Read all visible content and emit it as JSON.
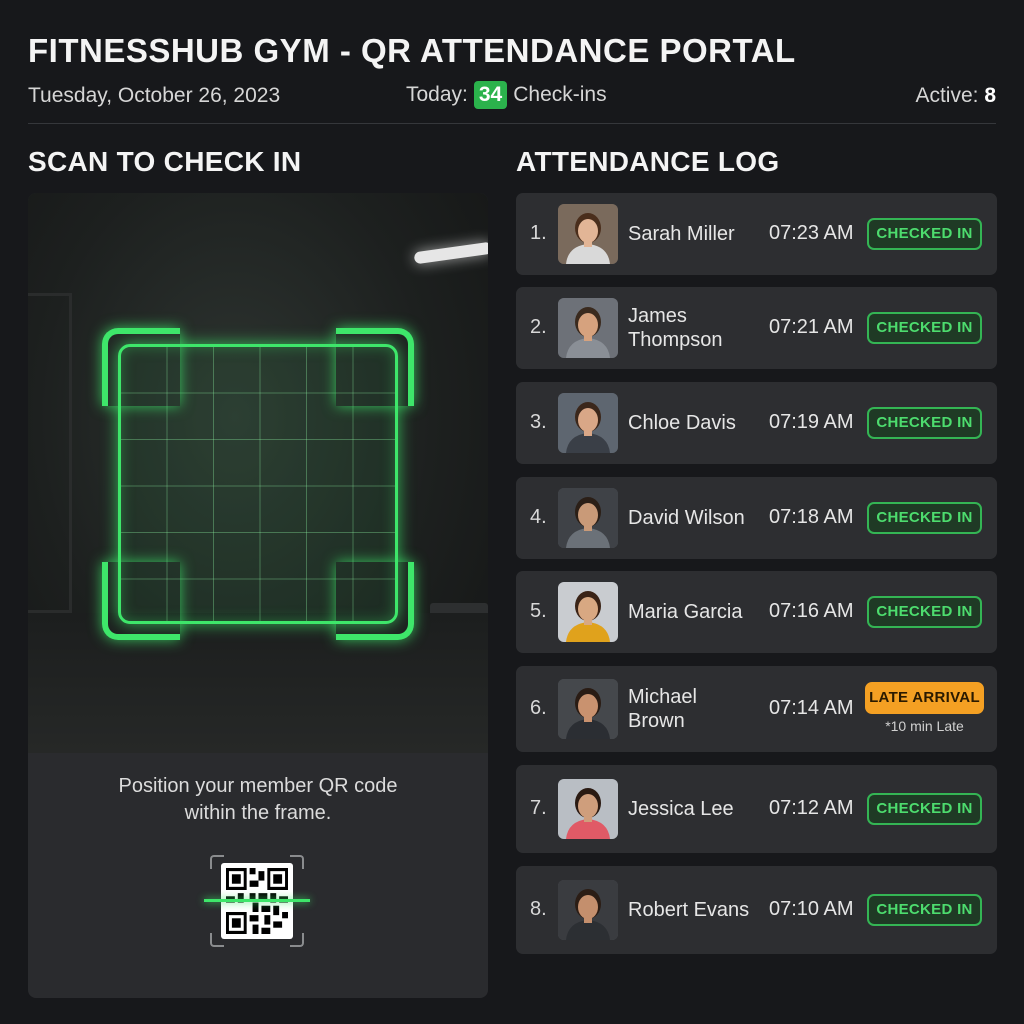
{
  "header": {
    "title": "FITNESSHUB GYM - QR ATTENDANCE PORTAL",
    "date": "Tuesday, October 26, 2023",
    "today_label": "Today:",
    "today_count": "34",
    "today_suffix": "Check-ins",
    "active_label": "Active:",
    "active_count": "8"
  },
  "scan": {
    "heading": "SCAN TO CHECK IN",
    "instruction_line1": "Position your member QR code",
    "instruction_line2": "within the frame."
  },
  "log": {
    "heading": "ATTENDANCE LOG",
    "rows": [
      {
        "num": "1.",
        "name_line1": "Sarah Miller",
        "name_line2": "",
        "time": "07:23 AM",
        "status": "CHECKED IN",
        "note": ""
      },
      {
        "num": "2.",
        "name_line1": "James",
        "name_line2": "Thompson",
        "time": "07:21 AM",
        "status": "CHECKED IN",
        "note": ""
      },
      {
        "num": "3.",
        "name_line1": "Chloe Davis",
        "name_line2": "",
        "time": "07:19 AM",
        "status": "CHECKED IN",
        "note": ""
      },
      {
        "num": "4.",
        "name_line1": "David Wilson",
        "name_line2": "",
        "time": "07:18 AM",
        "status": "CHECKED IN",
        "note": ""
      },
      {
        "num": "5.",
        "name_line1": "Maria Garcia",
        "name_line2": "",
        "time": "07:16 AM",
        "status": "CHECKED IN",
        "note": ""
      },
      {
        "num": "6.",
        "name_line1": "Michael",
        "name_line2": "Brown",
        "time": "07:14 AM",
        "status": "LATE ARRIVAL",
        "note": "*10 min Late"
      },
      {
        "num": "7.",
        "name_line1": "Jessica Lee",
        "name_line2": "",
        "time": "07:12 AM",
        "status": "CHECKED IN",
        "note": ""
      },
      {
        "num": "8.",
        "name_line1": "Robert Evans",
        "name_line2": "",
        "time": "07:10 AM",
        "status": "CHECKED IN",
        "note": ""
      }
    ]
  },
  "colors": {
    "accent_green": "#3ee66a",
    "badge_green": "#2bb24c",
    "late_orange": "#f4a023",
    "background": "#17181b",
    "row_background": "#2d2e31"
  }
}
